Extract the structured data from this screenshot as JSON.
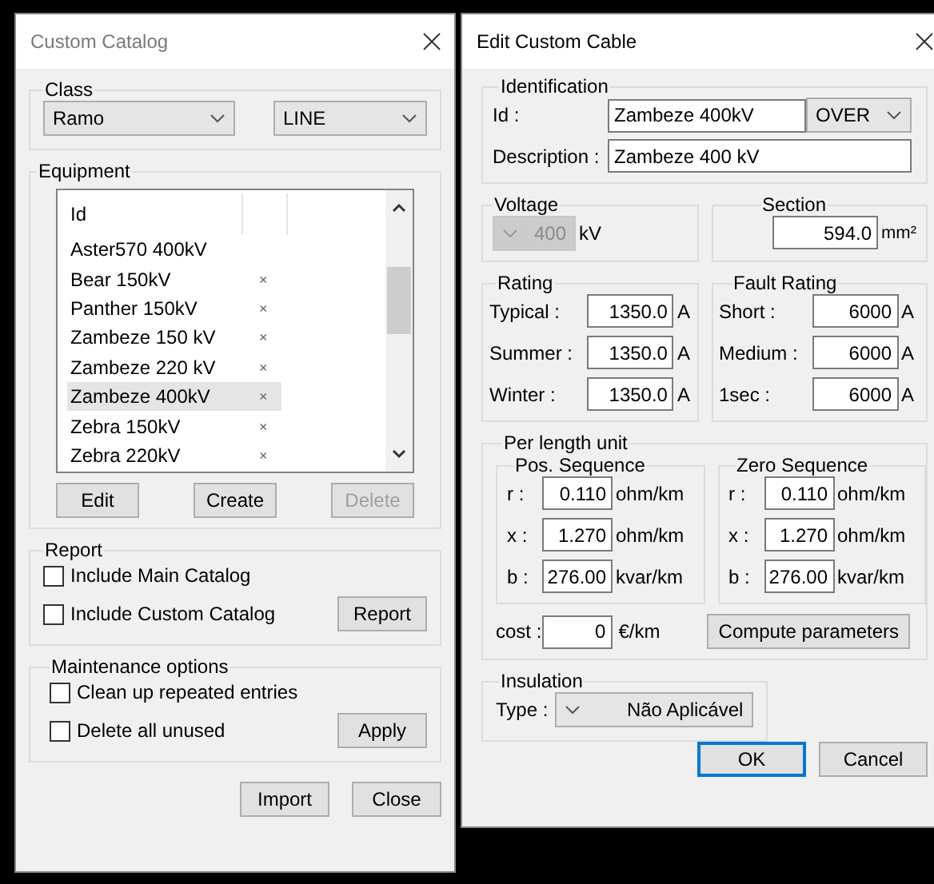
{
  "catalog_window": {
    "title": "Custom Catalog",
    "class_group": {
      "label": "Class",
      "selects": [
        "Ramo",
        "LINE"
      ]
    },
    "equipment_group": {
      "label": "Equipment",
      "columns": [
        "Id"
      ],
      "rows": [
        {
          "id": "Aster570 400kV",
          "mark": "",
          "selected": false
        },
        {
          "id": "Bear 150kV",
          "mark": "×",
          "selected": false
        },
        {
          "id": "Panther 150kV",
          "mark": "×",
          "selected": false
        },
        {
          "id": "Zambeze 150 kV",
          "mark": "×",
          "selected": false
        },
        {
          "id": "Zambeze 220 kV",
          "mark": "×",
          "selected": false
        },
        {
          "id": "Zambeze 400kV",
          "mark": "×",
          "selected": true
        },
        {
          "id": "Zebra 150kV",
          "mark": "×",
          "selected": false
        },
        {
          "id": "Zebra 220kV",
          "mark": "×",
          "selected": false
        }
      ],
      "buttons": [
        {
          "label": "Edit",
          "disabled": false
        },
        {
          "label": "Create",
          "disabled": false
        },
        {
          "label": "Delete",
          "disabled": true
        }
      ]
    },
    "report_group": {
      "label": "Report",
      "options": [
        {
          "label": "Include Main Catalog",
          "checked": false
        },
        {
          "label": "Include Custom Catalog",
          "checked": false
        }
      ],
      "button": "Report"
    },
    "maintenance_group": {
      "label": "Maintenance options",
      "options": [
        {
          "label": "Clean up repeated entries",
          "checked": false
        },
        {
          "label": "Delete all unused",
          "checked": false
        }
      ],
      "button": "Apply"
    },
    "buttons": [
      "Import",
      "Close"
    ]
  },
  "cable_window": {
    "title": "Edit Custom Cable",
    "identification": {
      "label": "Identification",
      "id_label": "Id :",
      "id_value": "Zambeze 400kV",
      "type_select": "OVER",
      "description_label": "Description :",
      "description_value": "Zambeze 400 kV"
    },
    "voltage": {
      "label": "Voltage",
      "value": "400",
      "unit": "kV",
      "disabled": true
    },
    "section": {
      "label": "Section",
      "value": "594.0",
      "unit": "mm²"
    },
    "rating": {
      "label": "Rating",
      "rows": [
        {
          "label": "Typical :",
          "value": "1350.0",
          "unit": "A"
        },
        {
          "label": "Summer :",
          "value": "1350.0",
          "unit": "A"
        },
        {
          "label": "Winter :",
          "value": "1350.0",
          "unit": "A"
        }
      ]
    },
    "fault_rating": {
      "label": "Fault Rating",
      "rows": [
        {
          "label": "Short :",
          "value": "6000",
          "unit": "A"
        },
        {
          "label": "Medium :",
          "value": "6000",
          "unit": "A"
        },
        {
          "label": "1sec :",
          "value": "6000",
          "unit": "A"
        }
      ]
    },
    "per_length": {
      "label": "Per length unit",
      "sequences": [
        {
          "label": "Pos. Sequence",
          "rows": [
            {
              "label": "r :",
              "value": "0.110",
              "unit": "ohm/km"
            },
            {
              "label": "x :",
              "value": "1.270",
              "unit": "ohm/km"
            },
            {
              "label": "b :",
              "value": "276.00",
              "unit": "kvar/km"
            }
          ]
        },
        {
          "label": "Zero Sequence",
          "rows": [
            {
              "label": "r :",
              "value": "0.110",
              "unit": "ohm/km"
            },
            {
              "label": "x :",
              "value": "1.270",
              "unit": "ohm/km"
            },
            {
              "label": "b :",
              "value": "276.00",
              "unit": "kvar/km"
            }
          ]
        }
      ],
      "cost_label": "cost :",
      "cost_value": "0",
      "cost_unit": "€/km",
      "compute_button": "Compute parameters"
    },
    "insulation": {
      "label": "Insulation",
      "type_label": "Type :",
      "type_value": "Não Aplicável"
    },
    "buttons": [
      {
        "label": "OK",
        "default": true
      },
      {
        "label": "Cancel",
        "default": false
      }
    ]
  }
}
